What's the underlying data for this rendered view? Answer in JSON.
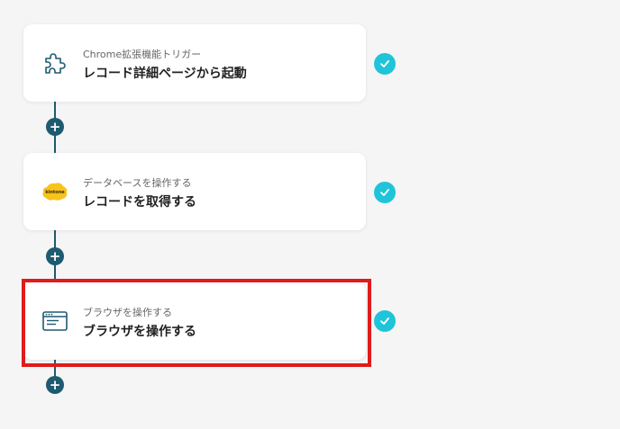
{
  "flow": {
    "steps": [
      {
        "subtitle": "Chrome拡張機能トリガー",
        "title": "レコード詳細ページから起動",
        "icon": "puzzle-icon",
        "status": "complete"
      },
      {
        "subtitle": "データベースを操作する",
        "title": "レコードを取得する",
        "icon": "kintone-logo",
        "icon_text": "kintone",
        "status": "complete"
      },
      {
        "subtitle": "ブラウザを操作する",
        "title": "ブラウザを操作する",
        "icon": "browser-window-icon",
        "status": "complete",
        "highlighted": true
      }
    ],
    "add_step_symbol": "+"
  },
  "colors": {
    "background": "#f5f5f5",
    "connector": "#1e5a70",
    "check": "#20c4d8",
    "highlight": "#e01b1b",
    "kintone_yellow": "#f7c31c"
  }
}
